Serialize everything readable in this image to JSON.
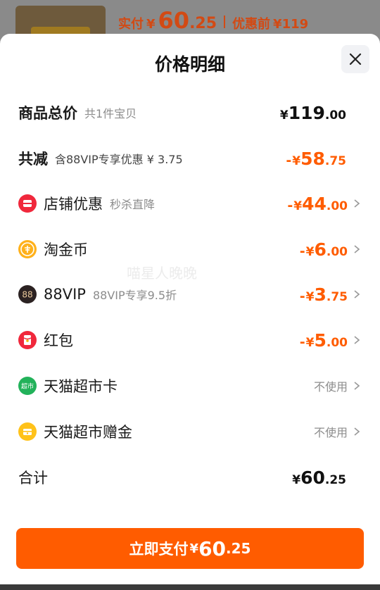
{
  "background": {
    "paid_label": "实付",
    "yen": "¥",
    "paid_int": "60",
    "paid_dec": ".25",
    "before_label": "优惠前",
    "before_price": "¥119"
  },
  "sheet": {
    "title": "价格明细",
    "close_icon": "close-icon"
  },
  "rows": {
    "total": {
      "label": "商品总价",
      "sub": "共1件宝贝",
      "yen": "¥",
      "int": "119",
      "dec": ".00"
    },
    "reduction": {
      "label": "共减",
      "sub": "含88VIP专享优惠 ¥ 3.75",
      "minus": "-",
      "yen": "¥",
      "int": "58",
      "dec": ".75"
    },
    "store": {
      "label": "店铺优惠",
      "sub": "秒杀直降",
      "minus": "-",
      "yen": "¥",
      "int": "44",
      "dec": ".00",
      "icon": "store-coupon-icon"
    },
    "coin": {
      "label": "淘金币",
      "minus": "-",
      "yen": "¥",
      "int": "6",
      "dec": ".00",
      "icon": "taojinbi-coin-icon"
    },
    "vip": {
      "label": "88VIP",
      "sub": "88VIP专享9.5折",
      "minus": "-",
      "yen": "¥",
      "int": "3",
      "dec": ".75",
      "icon": "88vip-badge-icon",
      "icon_text": "88"
    },
    "redpacket": {
      "label": "红包",
      "minus": "-",
      "yen": "¥",
      "int": "5",
      "dec": ".00",
      "icon": "red-packet-icon"
    },
    "supermarket_card": {
      "label": "天猫超市卡",
      "value": "不使用",
      "icon": "tmall-supermarket-card-icon",
      "icon_text": "超市"
    },
    "supermarket_gift": {
      "label": "天猫超市赠金",
      "value": "不使用",
      "icon": "tmall-gift-money-icon"
    },
    "sum": {
      "label": "合计",
      "yen": "¥",
      "int": "60",
      "dec": ".25"
    }
  },
  "pay_button": {
    "label": "立即支付",
    "yen": "¥",
    "int": "60",
    "dec": ".25"
  },
  "watermark": "喵星人晚晚",
  "colors": {
    "accent": "#ff5c00",
    "text": "#1a1a1a",
    "muted": "#8c8c8c"
  }
}
